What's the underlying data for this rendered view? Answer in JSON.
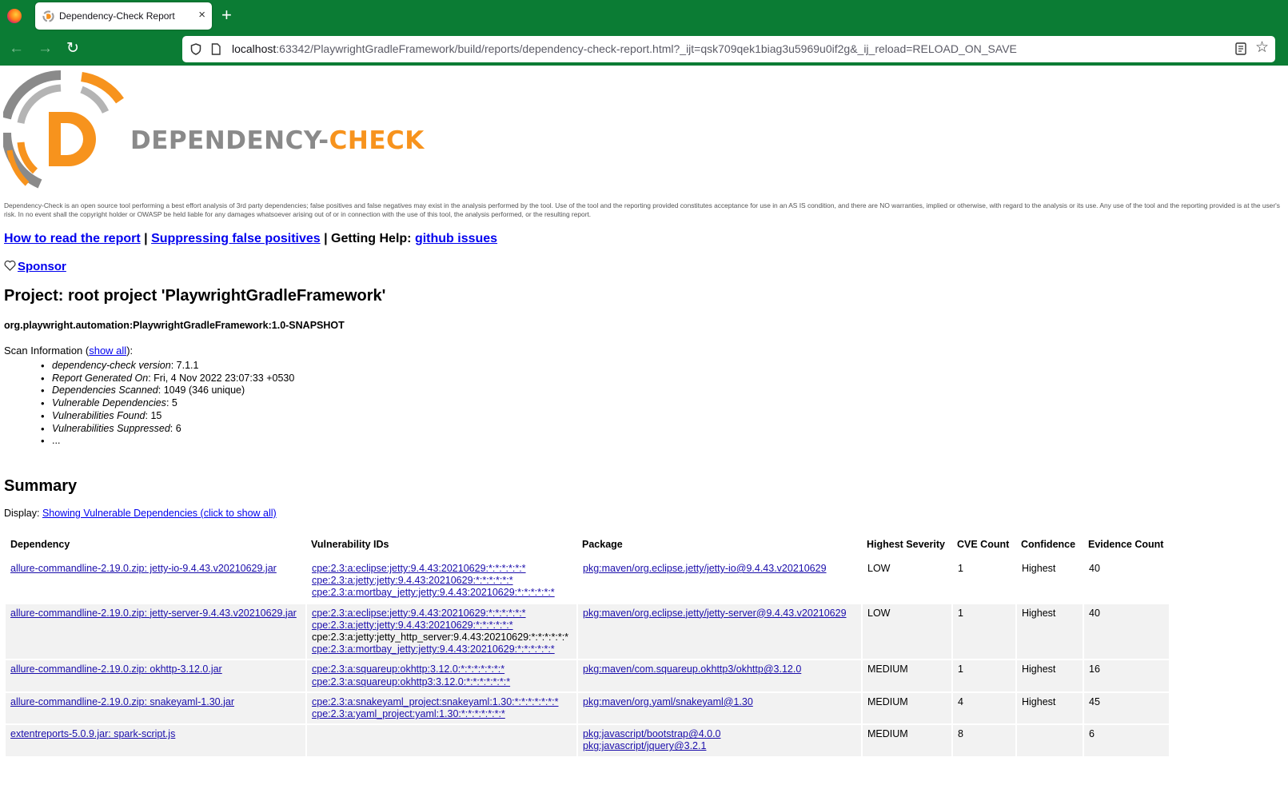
{
  "browser": {
    "tab_title": "Dependency-Check Report",
    "tab_close": "×",
    "new_tab": "+",
    "url_host": "localhost",
    "url_rest": ":63342/PlaywrightGradleFramework/build/reports/dependency-check-report.html?_ijt=qsk709qek1biag3u5969u0if2g&_ij_reload=RELOAD_ON_SAVE",
    "back": "←",
    "forward": "→",
    "reload": "↻",
    "star": "☆"
  },
  "logo": {
    "word_dep": "DEPENDENCY-",
    "word_check": "CHECK"
  },
  "disclaimer": "Dependency-Check is an open source tool performing a best effort analysis of 3rd party dependencies; false positives and false negatives may exist in the analysis performed by the tool. Use of the tool and the reporting provided constitutes acceptance for use in an AS IS condition, and there are NO warranties, implied or otherwise, with regard to the analysis or its use. Any use of the tool and the reporting provided is at the user's risk. In no event shall the copyright holder or OWASP be held liable for any damages whatsoever arising out of or in connection with the use of this tool, the analysis performed, or the resulting report.",
  "links": {
    "how_to_read": "How to read the report",
    "sep1": " | ",
    "suppressing": "Suppressing false positives",
    "sep2": " | Getting Help: ",
    "github": "github issues"
  },
  "sponsor": "Sponsor",
  "project": {
    "title": "Project: root project 'PlaywrightGradleFramework'",
    "gav": "org.playwright.automation:PlaywrightGradleFramework:1.0-SNAPSHOT"
  },
  "scan": {
    "label": "Scan Information (",
    "show_all": "show all",
    "label_end": "):",
    "items": [
      {
        "key": "dependency-check version",
        "value": ": 7.1.1"
      },
      {
        "key": "Report Generated On",
        "value": ": Fri, 4 Nov 2022 23:07:33 +0530"
      },
      {
        "key": "Dependencies Scanned",
        "value": ": 1049 (346 unique)"
      },
      {
        "key": "Vulnerable Dependencies",
        "value": ": 5"
      },
      {
        "key": "Vulnerabilities Found",
        "value": ": 15"
      },
      {
        "key": "Vulnerabilities Suppressed",
        "value": ": 6"
      },
      {
        "key": "",
        "value": "..."
      }
    ]
  },
  "summary": {
    "title": "Summary",
    "display_label": "Display: ",
    "display_link": "Showing Vulnerable Dependencies (click to show all)",
    "headers": {
      "dependency": "Dependency",
      "vuln_ids": "Vulnerability IDs",
      "package": "Package",
      "severity": "Highest Severity",
      "cve_count": "CVE Count",
      "confidence": "Confidence",
      "evidence_count": "Evidence Count"
    },
    "rows": [
      {
        "dependency": "allure-commandline-2.19.0.zip: jetty-io-9.4.43.v20210629.jar",
        "vuln_ids": [
          {
            "text": "cpe:2.3:a:eclipse:jetty:9.4.43:20210629:*:*:*:*:*:*",
            "link": true
          },
          {
            "text": "cpe:2.3:a:jetty:jetty:9.4.43:20210629:*:*:*:*:*:*",
            "link": true
          },
          {
            "text": "cpe:2.3:a:mortbay_jetty:jetty:9.4.43:20210629:*:*:*:*:*:*",
            "link": true
          }
        ],
        "packages": [
          "pkg:maven/org.eclipse.jetty/jetty-io@9.4.43.v20210629"
        ],
        "severity": "LOW",
        "cve_count": "1",
        "confidence": "Highest",
        "evidence_count": "40"
      },
      {
        "dependency": "allure-commandline-2.19.0.zip: jetty-server-9.4.43.v20210629.jar",
        "vuln_ids": [
          {
            "text": "cpe:2.3:a:eclipse:jetty:9.4.43:20210629:*:*:*:*:*:*",
            "link": true
          },
          {
            "text": "cpe:2.3:a:jetty:jetty:9.4.43:20210629:*:*:*:*:*:*",
            "link": true
          },
          {
            "text": "cpe:2.3:a:jetty:jetty_http_server:9.4.43:20210629:*:*:*:*:*:*",
            "link": false
          },
          {
            "text": "cpe:2.3:a:mortbay_jetty:jetty:9.4.43:20210629:*:*:*:*:*:*",
            "link": true
          }
        ],
        "packages": [
          "pkg:maven/org.eclipse.jetty/jetty-server@9.4.43.v20210629"
        ],
        "severity": "LOW",
        "cve_count": "1",
        "confidence": "Highest",
        "evidence_count": "40"
      },
      {
        "dependency": "allure-commandline-2.19.0.zip: okhttp-3.12.0.jar",
        "vuln_ids": [
          {
            "text": "cpe:2.3:a:squareup:okhttp:3.12.0:*:*:*:*:*:*:*",
            "link": true
          },
          {
            "text": "cpe:2.3:a:squareup:okhttp3:3.12.0:*:*:*:*:*:*:*",
            "link": true
          }
        ],
        "packages": [
          "pkg:maven/com.squareup.okhttp3/okhttp@3.12.0"
        ],
        "severity": "MEDIUM",
        "cve_count": "1",
        "confidence": "Highest",
        "evidence_count": "16"
      },
      {
        "dependency": "allure-commandline-2.19.0.zip: snakeyaml-1.30.jar",
        "vuln_ids": [
          {
            "text": "cpe:2.3:a:snakeyaml_project:snakeyaml:1.30:*:*:*:*:*:*:*",
            "link": true
          },
          {
            "text": "cpe:2.3:a:yaml_project:yaml:1.30:*:*:*:*:*:*:*",
            "link": true
          }
        ],
        "packages": [
          "pkg:maven/org.yaml/snakeyaml@1.30"
        ],
        "severity": "MEDIUM",
        "cve_count": "4",
        "confidence": "Highest",
        "evidence_count": "45"
      },
      {
        "dependency": "extentreports-5.0.9.jar: spark-script.js",
        "vuln_ids": [],
        "packages": [
          "pkg:javascript/bootstrap@4.0.0",
          "pkg:javascript/jquery@3.2.1"
        ],
        "severity": "MEDIUM",
        "cve_count": "8",
        "confidence": "",
        "evidence_count": "6"
      }
    ]
  },
  "colors": {
    "browser_green": "#0b7c34",
    "logo_orange": "#f7931d",
    "logo_gray": "#8a8a8a",
    "link_blue": "#0000ee",
    "row_alt": "#f2f2f2"
  }
}
